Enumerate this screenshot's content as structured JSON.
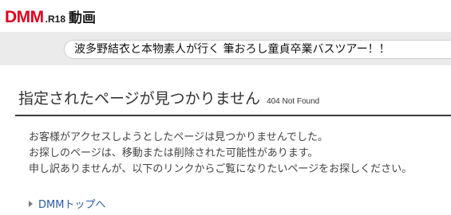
{
  "header": {
    "logo_text": "DMM",
    "logo_suffix": ".R18",
    "section_label": "動画"
  },
  "banner": {
    "text": "波多野結衣と本物素人が行く 筆おろし童貞卒業バスツアー！！"
  },
  "main": {
    "title": "指定されたページが見つかりません",
    "status": "404 Not Found",
    "message_lines": [
      "お客様がアクセスしようとしたページは見つかりませんでした。",
      "お探しのページは、移動または削除された可能性があります。",
      "申し訳ありませんが、以下のリンクからご覧になりたいページをお探しください。"
    ],
    "link_label": "DMMトップへ"
  },
  "colors": {
    "brand_red": "#e0001f",
    "link_blue": "#2b5aa8",
    "rule_dark": "#3a3a3a",
    "strip_gray": "#ebebeb"
  },
  "icons": {
    "link_arrow": "triangle-right-icon"
  }
}
